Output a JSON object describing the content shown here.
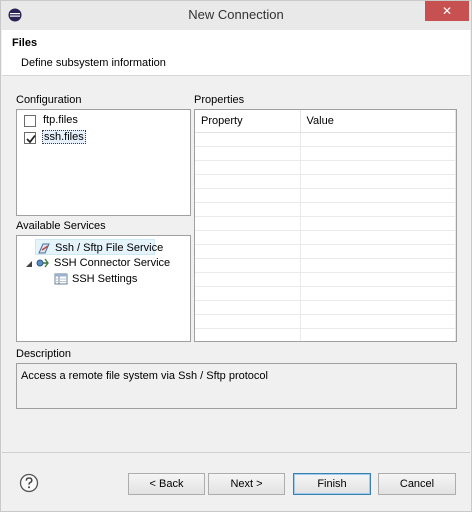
{
  "window": {
    "title": "New Connection",
    "close_glyph": "✕"
  },
  "header": {
    "title": "Files",
    "subtitle": "Define subsystem information"
  },
  "configuration": {
    "label": "Configuration",
    "items": [
      {
        "label": "ftp.files",
        "checked": false
      },
      {
        "label": "ssh.files",
        "checked": true
      }
    ]
  },
  "services": {
    "label": "Available Services",
    "items": [
      {
        "label": "Ssh / Sftp File Service",
        "icon": "file-service-icon"
      },
      {
        "label": "SSH Connector Service",
        "icon": "connector-icon"
      },
      {
        "label": "SSH Settings",
        "icon": "settings-table-icon"
      }
    ]
  },
  "properties": {
    "label": "Properties",
    "columns": [
      "Property",
      "Value"
    ]
  },
  "description": {
    "label": "Description",
    "text": "Access a remote file system via Ssh / Sftp protocol"
  },
  "buttons": {
    "back": "< Back",
    "next": "Next >",
    "finish": "Finish",
    "cancel": "Cancel"
  },
  "colors": {
    "close_bg": "#c75050",
    "selection_bg": "#e5f3fb",
    "primary_border": "#3c7fb1"
  }
}
